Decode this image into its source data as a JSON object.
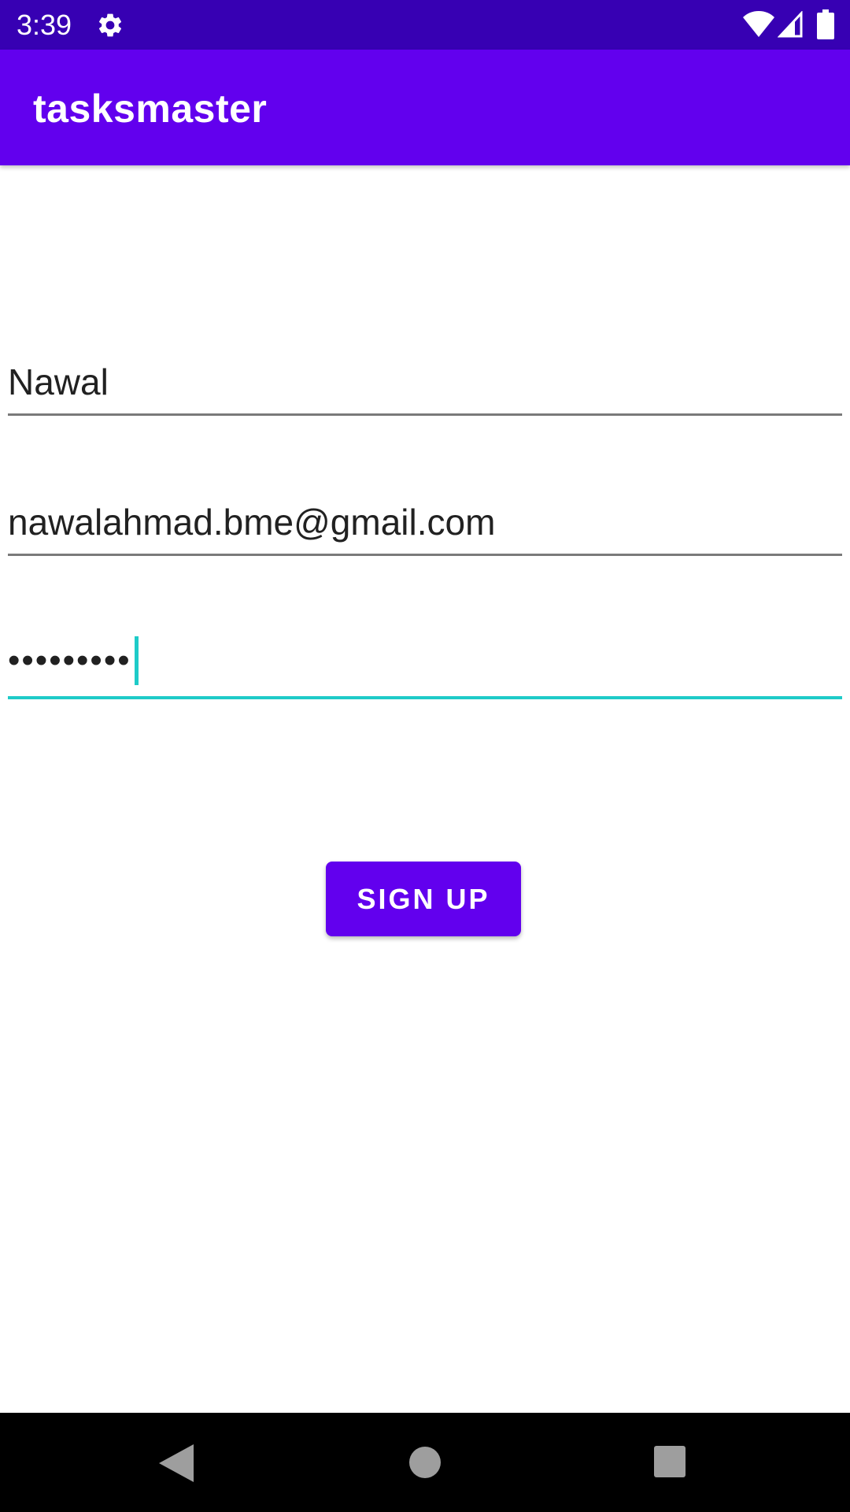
{
  "status_bar": {
    "time": "3:39",
    "icons": [
      "gear-icon",
      "wifi-icon",
      "signal-icon",
      "battery-icon"
    ]
  },
  "app_bar": {
    "title": "tasksmaster"
  },
  "form": {
    "username_value": "Nawal",
    "email_value": "nawalahmad.bme@gmail.com",
    "password_value": "•••••••••"
  },
  "signup_label": "SIGN UP",
  "nav_bar": {
    "icons": [
      "back-icon",
      "home-icon",
      "recents-icon"
    ]
  },
  "colors": {
    "status_bar": "#3700b3",
    "primary": "#6200ee",
    "accent": "#1ecbc8"
  }
}
